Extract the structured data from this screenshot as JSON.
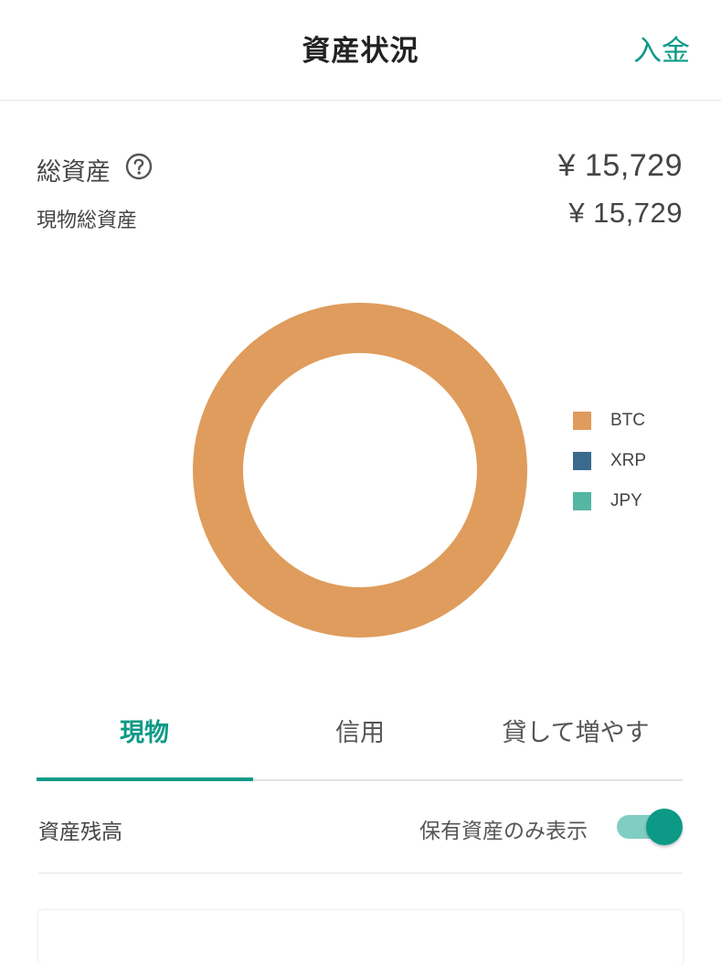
{
  "header": {
    "title": "資産状況",
    "deposit_label": "入金"
  },
  "summary": {
    "total_label": "総資産",
    "total_value": "¥ 15,729",
    "spot_label": "現物総資産",
    "spot_value": "¥ 15,729",
    "help_icon": "question-circle-icon"
  },
  "chart_data": {
    "type": "pie",
    "donut": true,
    "categories": [
      "BTC",
      "XRP",
      "JPY"
    ],
    "values": [
      100,
      0,
      0
    ],
    "colors": [
      "#df9c5c",
      "#3a6b8e",
      "#55b6a2"
    ],
    "legend": "right"
  },
  "tabs": [
    {
      "label": "現物",
      "active": true
    },
    {
      "label": "信用",
      "active": false
    },
    {
      "label": "貸して増やす",
      "active": false
    }
  ],
  "balance": {
    "label": "資産残高",
    "toggle_label": "保有資産のみ表示",
    "toggle_on": true
  },
  "colors": {
    "accent": "#0c9a87",
    "accent_light": "#80cec3"
  }
}
